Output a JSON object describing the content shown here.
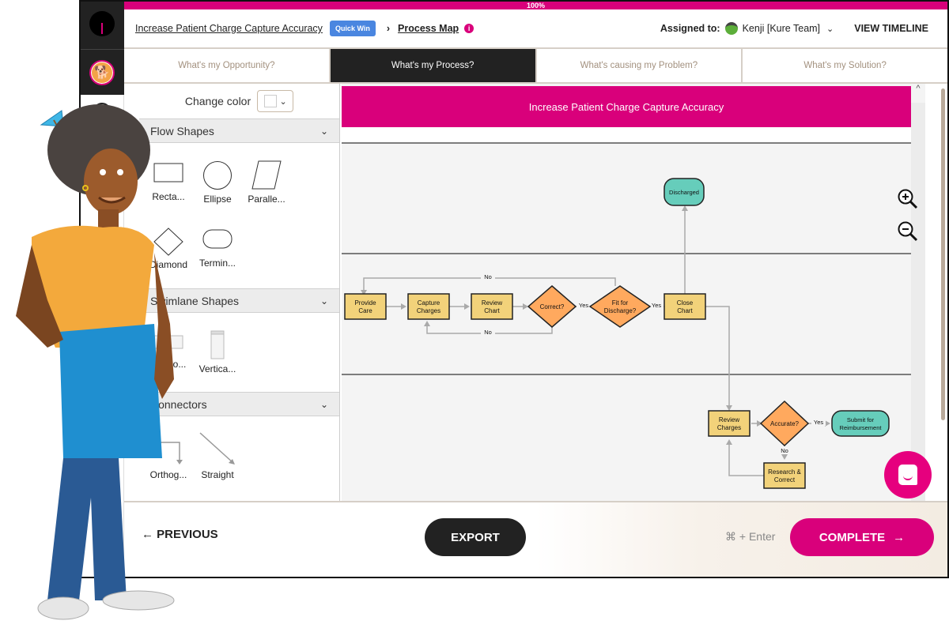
{
  "progress": {
    "label": "100%",
    "value_percent": 100
  },
  "header": {
    "breadcrumb_project": "Increase Patient Charge Capture Accuracy",
    "badge": "Quick Win",
    "breadcrumb_separator": "›",
    "breadcrumb_page": "Process Map",
    "info_icon": "i",
    "assigned_label": "Assigned to:",
    "assignee": "Kenji [Kure Team]",
    "view_timeline": "VIEW TIMELINE"
  },
  "tabs": [
    {
      "label": "What's my Opportunity?",
      "active": false
    },
    {
      "label": "What's my Process?",
      "active": true
    },
    {
      "label": "What's causing my Problem?",
      "active": false
    },
    {
      "label": "What's my Solution?",
      "active": false
    }
  ],
  "palette": {
    "change_color_label": "Change color",
    "sections": [
      {
        "title": "Flow Shapes",
        "items": [
          "Recta...",
          "Ellipse",
          "Paralle...",
          "Diamond",
          "Termin..."
        ]
      },
      {
        "title": "Swimlane Shapes",
        "items": [
          "Horizo...",
          "Vertica..."
        ]
      },
      {
        "title": "Connectors",
        "items": [
          "Orthog...",
          "Straight"
        ]
      }
    ]
  },
  "diagram": {
    "title": "Increase Patient Charge Capture Accuracy",
    "colors": {
      "title_bg": "#d9007b",
      "process": "#f2d27a",
      "decision": "#ffa95e",
      "terminal": "#66cdbb"
    },
    "nodes": {
      "discharged": "Discharged",
      "provide_care": [
        "Provide",
        "Care"
      ],
      "capture_charges": [
        "Capture",
        "Charges"
      ],
      "review_chart": [
        "Review",
        "Chart"
      ],
      "correct": "Correct?",
      "fit_for_discharge": [
        "Fit for",
        "Discharge?"
      ],
      "close_chart": [
        "Close",
        "Chart"
      ],
      "review_charges": [
        "Review",
        "Charges"
      ],
      "accurate": "Accurate?",
      "submit": [
        "Submit for",
        "Reimbursement"
      ],
      "research_correct": [
        "Research &",
        "Correct"
      ]
    },
    "edge_labels": {
      "yes": "Yes",
      "no": "No"
    }
  },
  "footer": {
    "previous": "PREVIOUS",
    "export": "EXPORT",
    "shortcut": "⌘ + Enter",
    "complete": "COMPLETE"
  }
}
